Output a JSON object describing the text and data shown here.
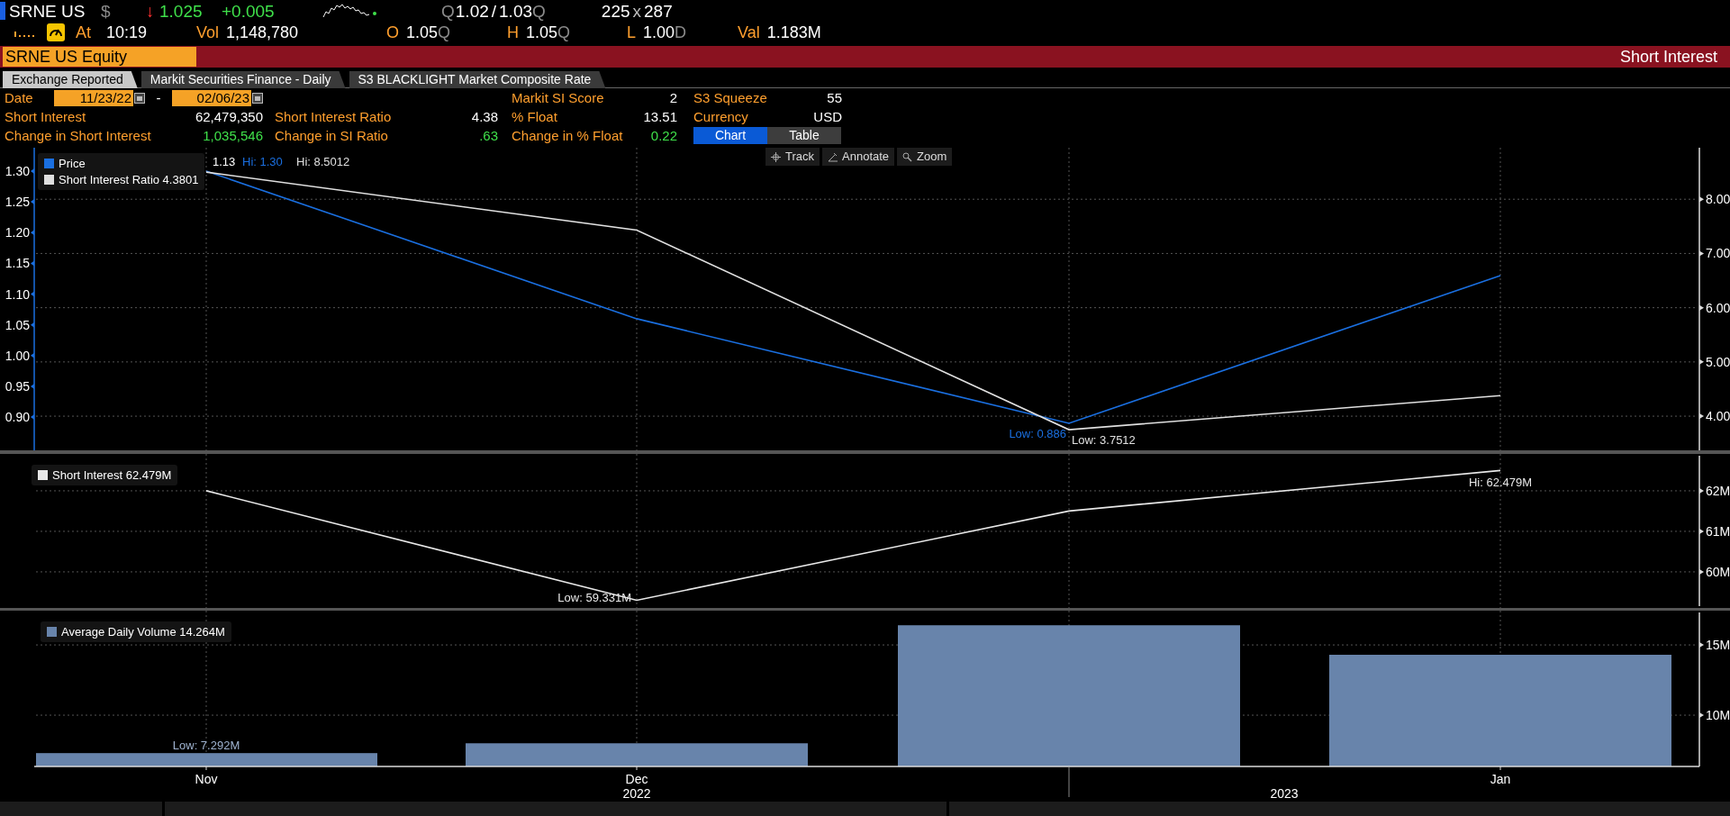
{
  "quote_line": {
    "ticker": "SRNE US",
    "currency": "$",
    "arrow": "↓",
    "last": "1.025",
    "change": "+0.005",
    "bid_source": "Q",
    "bid": "1.02",
    "separator": "/",
    "ask": "1.03",
    "ask_source": "Q",
    "bid_size": "225",
    "size_separator": "x",
    "ask_size": "287"
  },
  "trade_line": {
    "time_label": "At",
    "time": "10:19",
    "fields": [
      {
        "label": "Vol",
        "value": "1,148,780"
      },
      {
        "label": "O",
        "value": "1.05",
        "source": "Q"
      },
      {
        "label": "H",
        "value": "1.05",
        "source": "Q"
      },
      {
        "label": "L",
        "value": "1.00",
        "source": "D"
      },
      {
        "label": "Val",
        "value": "1.183M"
      }
    ]
  },
  "title_bar": {
    "security": "SRNE US Equity",
    "function": "Short Interest"
  },
  "source_tabs": [
    {
      "label": "Exchange Reported",
      "selected": true
    },
    {
      "label": "Markit Securities Finance - Daily",
      "selected": false
    },
    {
      "label": "S3 BLACKLIGHT Market Composite Rate",
      "selected": false
    }
  ],
  "stat_rows": [
    {
      "date_range": {
        "label": "Date",
        "from": "11/23/22",
        "separator": "-",
        "to": "02/06/23"
      },
      "cells": [
        {
          "label": "Markit SI Score",
          "value": "2",
          "kind": "level"
        },
        {
          "label": "S3 Squeeze",
          "value": "55",
          "kind": "level"
        }
      ]
    },
    {
      "cells": [
        {
          "label": "Short Interest",
          "value": "62,479,350",
          "kind": "level"
        },
        {
          "label": "Short Interest Ratio",
          "value": "4.38",
          "kind": "level"
        },
        {
          "label": "% Float",
          "value": "13.51",
          "kind": "level"
        },
        {
          "label": "Currency",
          "value": "USD",
          "kind": "level"
        }
      ]
    },
    {
      "cells": [
        {
          "label": "Change in Short Interest",
          "value": "1,035,546",
          "kind": "change"
        },
        {
          "label": "Change in SI Ratio",
          "value": ".63",
          "kind": "change"
        },
        {
          "label": "Change in % Float",
          "value": "0.22",
          "kind": "change"
        }
      ],
      "view_toggle": [
        {
          "label": "Chart",
          "selected": true
        },
        {
          "label": "Table",
          "selected": false
        }
      ]
    }
  ],
  "chart_tools": [
    {
      "label": "Track",
      "kind": "track"
    },
    {
      "label": "Annotate",
      "kind": "annotate"
    },
    {
      "label": "Zoom",
      "kind": "zoom"
    }
  ],
  "price_panel": {
    "legend_items": [
      {
        "kind": "name_only"
      },
      {
        "kind": "with_value",
        "value": "4.3801"
      }
    ],
    "chart_data": {
      "type": "line",
      "grid": true,
      "series": [
        {
          "name": "Price",
          "color": "#1a6fe0",
          "values": [
            1.3,
            1.06,
            0.89,
            1.13
          ]
        },
        {
          "name": "Short Interest Ratio",
          "color": "#e0e0e0",
          "axis": "y2",
          "values": [
            8.5,
            7.43,
            3.75,
            4.38
          ]
        }
      ],
      "ylim": [
        0.846,
        1.338
      ],
      "yticks": [
        {
          "value": 0.9,
          "label": "0.90"
        },
        {
          "value": 0.95,
          "label": "0.95"
        },
        {
          "value": 1.0,
          "label": "1.00"
        },
        {
          "value": 1.05,
          "label": "1.05"
        },
        {
          "value": 1.1,
          "label": "1.10"
        },
        {
          "value": 1.15,
          "label": "1.15"
        },
        {
          "value": 1.2,
          "label": "1.20"
        },
        {
          "value": 1.25,
          "label": "1.25"
        },
        {
          "value": 1.3,
          "label": "1.30"
        }
      ],
      "y2lim": [
        3.37,
        8.95
      ],
      "y2ticks": [
        {
          "value": 4,
          "label": "4.00"
        },
        {
          "value": 5,
          "label": "5.00"
        },
        {
          "value": 6,
          "label": "6.00"
        },
        {
          "value": 7,
          "label": "7.00"
        },
        {
          "value": 8,
          "label": "8.00"
        }
      ],
      "annotations": [
        {
          "text": "1.13"
        },
        {
          "text": "Hi: 1.30"
        },
        {
          "text": "Hi: 8.5012"
        },
        {
          "text": "Low: 0.886"
        },
        {
          "text": "Low: 3.7512"
        }
      ]
    }
  },
  "short_interest_panel": {
    "legend_items": [
      {
        "kind": "with_value",
        "value": "62.479M"
      }
    ],
    "chart_data": {
      "type": "line",
      "grid": true,
      "series": [
        {
          "name": "Short Interest",
          "color": "#e8e8e8",
          "values": [
            62.0,
            59.3,
            61.5,
            62.5
          ]
        }
      ],
      "ylim": [
        59.11,
        62.91
      ],
      "yticks": [
        {
          "value": 60,
          "label": "60M"
        },
        {
          "value": 61,
          "label": "61M"
        },
        {
          "value": 62,
          "label": "62M"
        }
      ],
      "annotations": [
        {
          "text": "Low: 59.331M"
        },
        {
          "text": "Hi: 62.479M"
        }
      ]
    }
  },
  "volume_panel": {
    "legend_items": [
      {
        "kind": "with_value",
        "value": "14.264M"
      }
    ],
    "chart_data": {
      "type": "bar",
      "grid": true,
      "categories": [
        "Nov",
        "Dec",
        null,
        "Jan"
      ],
      "series": [
        {
          "name": "Average Daily Volume",
          "color": "#6884ab",
          "values": [
            7.3,
            8.0,
            16.4,
            14.3
          ]
        }
      ],
      "ylim": [
        6.35,
        17.44
      ],
      "yticks": [
        {
          "value": 10,
          "label": "10M"
        },
        {
          "value": 15,
          "label": "15M"
        }
      ],
      "annotations": [
        {
          "text": "Low: 7.292M"
        }
      ]
    },
    "year_labels": [
      "2022",
      "2023"
    ]
  }
}
